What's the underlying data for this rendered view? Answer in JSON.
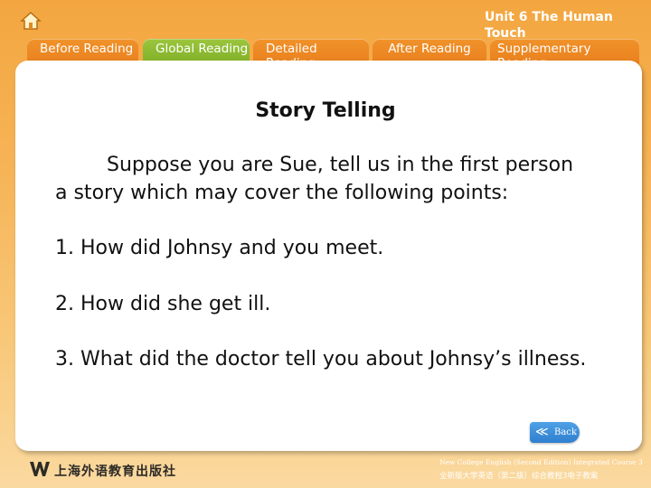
{
  "header": {
    "unit_title": "Unit 6 The Human Touch",
    "home_icon": "home-icon"
  },
  "tabs": [
    {
      "label": "Before Reading",
      "active": false
    },
    {
      "label": "Global Reading",
      "active": true
    },
    {
      "label": "Detailed Reading",
      "active": false
    },
    {
      "label": "After Reading",
      "active": false
    },
    {
      "label": "Supplementary Reading",
      "active": false
    }
  ],
  "content": {
    "heading": "Story Telling",
    "intro": "Suppose you are Sue, tell us in the first person a story which may cover the following points:",
    "points": [
      "1. How did Johnsy and you meet.",
      "2. How did she get ill.",
      "3. What did the doctor tell you about Johnsy’s illness."
    ]
  },
  "back_button": {
    "label": "Back",
    "icon": "double-chevron-left-icon"
  },
  "footer": {
    "publisher_cn": "上海外语教育出版社",
    "course_en": "New College English (Second Edition) Integrated Course 3",
    "course_zh": "全新版大学英语（第二版）综合教程3电子教案"
  },
  "colors": {
    "tab_orange": "#e97f1d",
    "tab_active_green": "#7fae28",
    "back_blue": "#2f7fcf"
  }
}
